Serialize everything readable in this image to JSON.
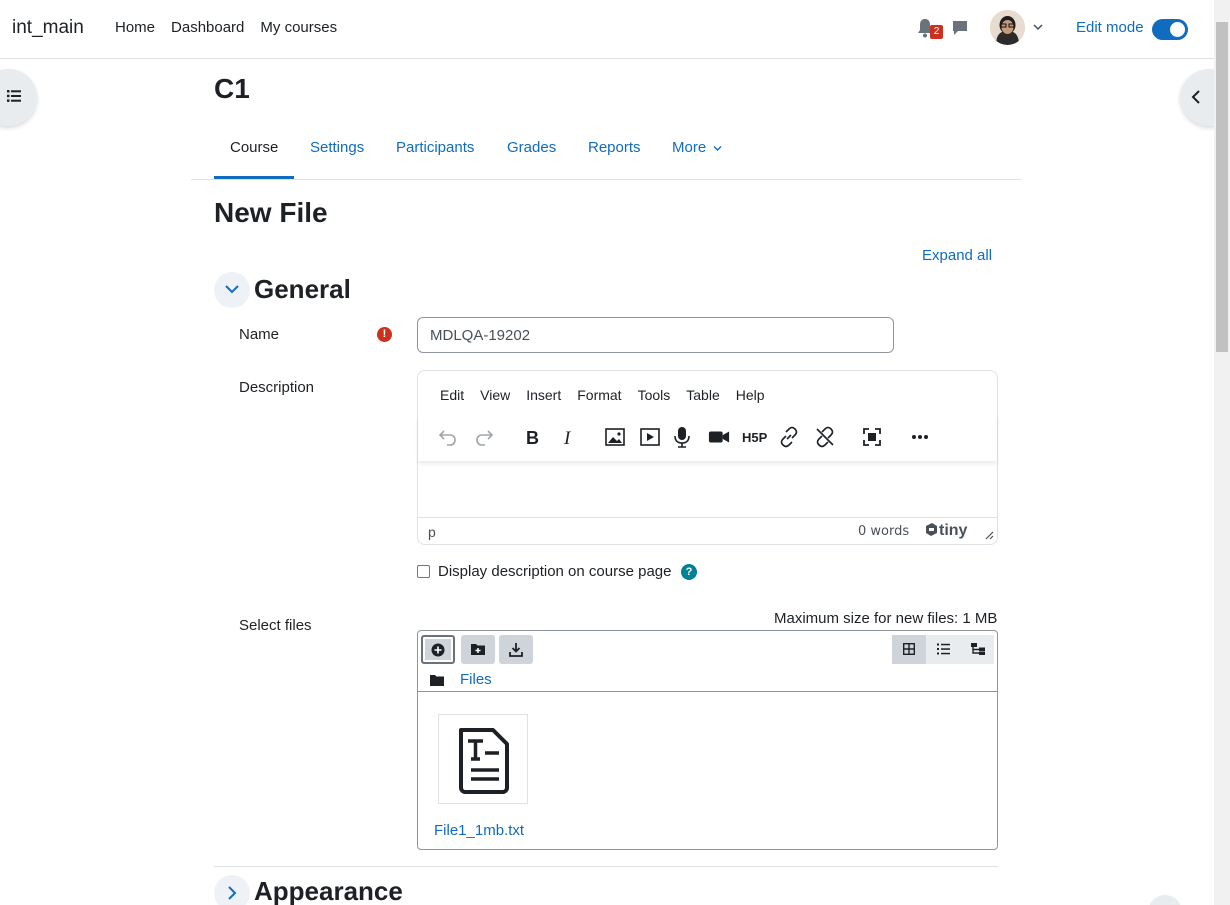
{
  "navbar": {
    "brand": "int_main",
    "links": [
      "Home",
      "Dashboard",
      "My courses"
    ],
    "notification_count": "2",
    "edit_mode_label": "Edit mode"
  },
  "course": {
    "title": "C1",
    "tabs": [
      "Course",
      "Settings",
      "Participants",
      "Grades",
      "Reports",
      "More"
    ],
    "active_tab": "Course"
  },
  "page": {
    "heading": "New File",
    "expand_all": "Expand all"
  },
  "general": {
    "title": "General",
    "name_label": "Name",
    "name_value": "MDLQA-19202",
    "description_label": "Description",
    "editor_menu": [
      "Edit",
      "View",
      "Insert",
      "Format",
      "Tools",
      "Table",
      "Help"
    ],
    "status_path": "p",
    "word_count": "0 words",
    "tiny_brand": "tiny",
    "display_description_label": "Display description on course page",
    "select_files_label": "Select files",
    "max_size": "Maximum size for new files: 1 MB",
    "files_path": "Files",
    "files": [
      {
        "name": "File1_1mb.txt"
      }
    ]
  },
  "appearance": {
    "title": "Appearance"
  },
  "colors": {
    "accent": "#0f6cbf",
    "required": "#ca3120",
    "help": "#008196"
  }
}
